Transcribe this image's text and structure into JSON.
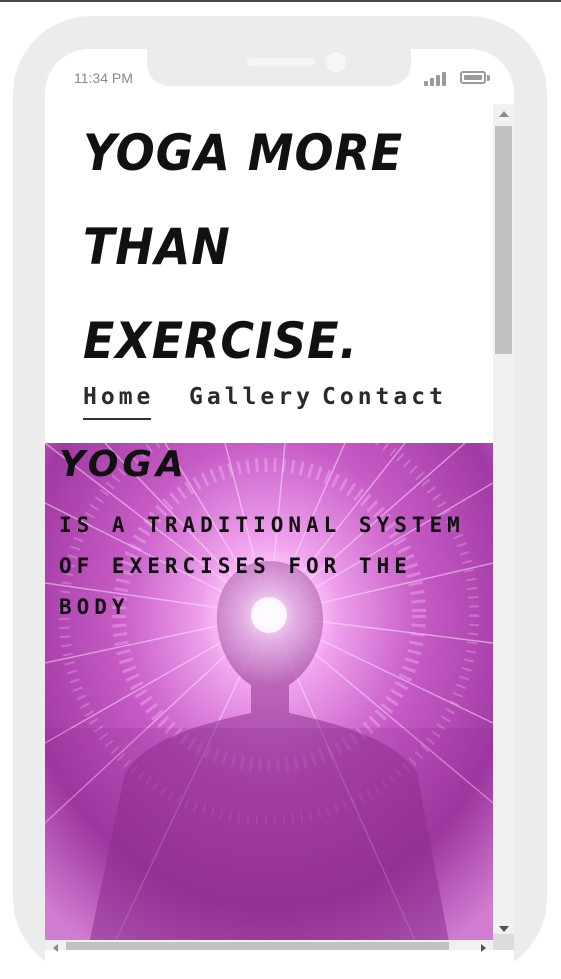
{
  "status_bar": {
    "time": "11:34 PM",
    "signal_icon": "signal-bars-icon",
    "battery_icon": "battery-icon"
  },
  "hero": {
    "title": "YOGA MORE THAN EXERCISE."
  },
  "nav": {
    "items": [
      {
        "label": "Home",
        "active": true
      },
      {
        "label": "Gallery",
        "active": false
      },
      {
        "label": "Contact",
        "active": false
      }
    ]
  },
  "banner": {
    "heading": "YOGA",
    "description": "IS A TRADITIONAL SYSTEM OF EXERCISES FOR THE BODY"
  },
  "colors": {
    "text": "#111111",
    "image_primary": "#c25ac2",
    "frame": "#ececec"
  }
}
